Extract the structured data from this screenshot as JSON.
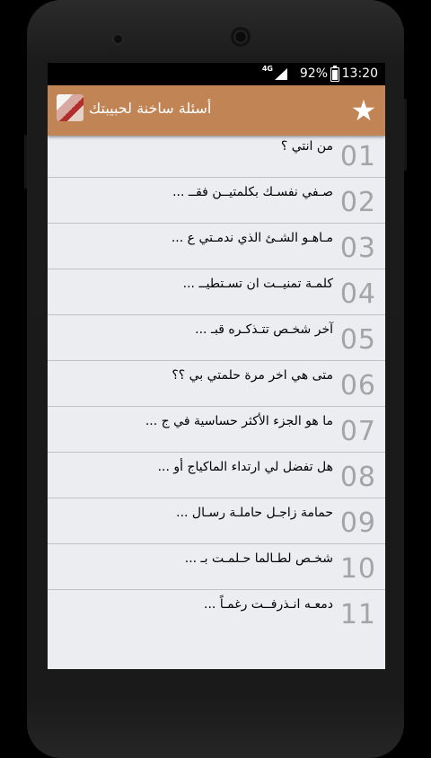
{
  "status_bar": {
    "network": "4G",
    "battery_percent": "92%",
    "time": "13:20"
  },
  "app_bar": {
    "title": "أسئلة ساخنة لحبيبتك",
    "favorite_icon": "star-icon"
  },
  "questions": [
    {
      "number": "01",
      "text": "من انتي ؟"
    },
    {
      "number": "02",
      "text": "صـفي نفسـك بكلمتيــن فقــ ..."
    },
    {
      "number": "03",
      "text": "مـاهـو الشـئ الذي ندمـتي ع ..."
    },
    {
      "number": "04",
      "text": "كلمـة تمنيــت ان تسـتطيــ ..."
    },
    {
      "number": "05",
      "text": "آخر شخـص تتـذكـره قبـ ..."
    },
    {
      "number": "06",
      "text": "متى هي اخر مرة حلمتي بي ؟؟"
    },
    {
      "number": "07",
      "text": "ما هو الجزء الأكثر حساسية في ج ..."
    },
    {
      "number": "08",
      "text": "هل تفضل لي ارتداء الماكياج أو ..."
    },
    {
      "number": "09",
      "text": "حمامة زاجـل حاملـة رسـال ..."
    },
    {
      "number": "10",
      "text": "شخـص لطـالما حـلمـت بـ ..."
    },
    {
      "number": "11",
      "text": "دمعـه انـذرفــت رغمـاً ..."
    }
  ]
}
